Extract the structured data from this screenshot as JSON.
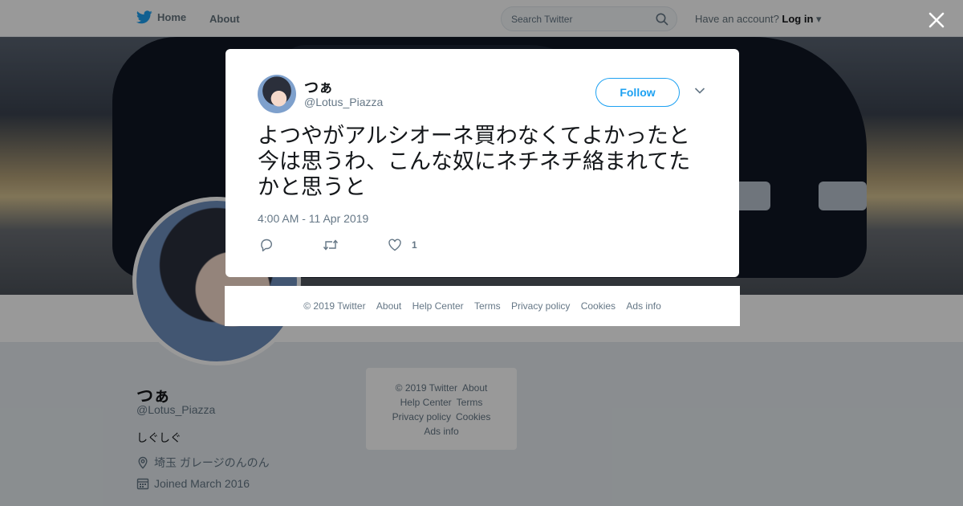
{
  "topbar": {
    "home_label": "Home",
    "about_label": "About",
    "search_placeholder": "Search Twitter",
    "login_prompt": "Have an account?",
    "login_label": "Log in"
  },
  "profile": {
    "name": "つぁ",
    "handle": "@Lotus_Piazza",
    "bio": "しぐしぐ",
    "location": "埼玉 ガレージのんのん",
    "joined": "Joined March 2016"
  },
  "side_footer": {
    "copyright": "© 2019 Twitter",
    "about": "About",
    "help": "Help Center",
    "terms": "Terms",
    "privacy": "Privacy policy",
    "cookies": "Cookies",
    "ads": "Ads info"
  },
  "tweet": {
    "author_name": "つぁ",
    "author_handle": "@Lotus_Piazza",
    "follow_label": "Follow",
    "text": "よつやがアルシオーネ買わなくてよかったと今は思うわ、こんな奴にネチネチ絡まれてたかと思うと",
    "timestamp": "4:00 AM - 11 Apr 2019",
    "like_count": "1"
  },
  "modal_footer": {
    "copyright": "© 2019 Twitter",
    "about": "About",
    "help": "Help Center",
    "terms": "Terms",
    "privacy": "Privacy policy",
    "cookies": "Cookies",
    "ads": "Ads info"
  },
  "icons": {
    "brand": "twitter-bird-icon",
    "search": "search-icon",
    "close": "close-icon",
    "reply": "reply-icon",
    "retweet": "retweet-icon",
    "like": "heart-icon",
    "more": "chevron-down-icon",
    "location": "location-pin-icon",
    "calendar": "calendar-icon"
  },
  "colors": {
    "accent": "#1da1f2",
    "text_primary": "#14171a",
    "text_secondary": "#657786"
  }
}
